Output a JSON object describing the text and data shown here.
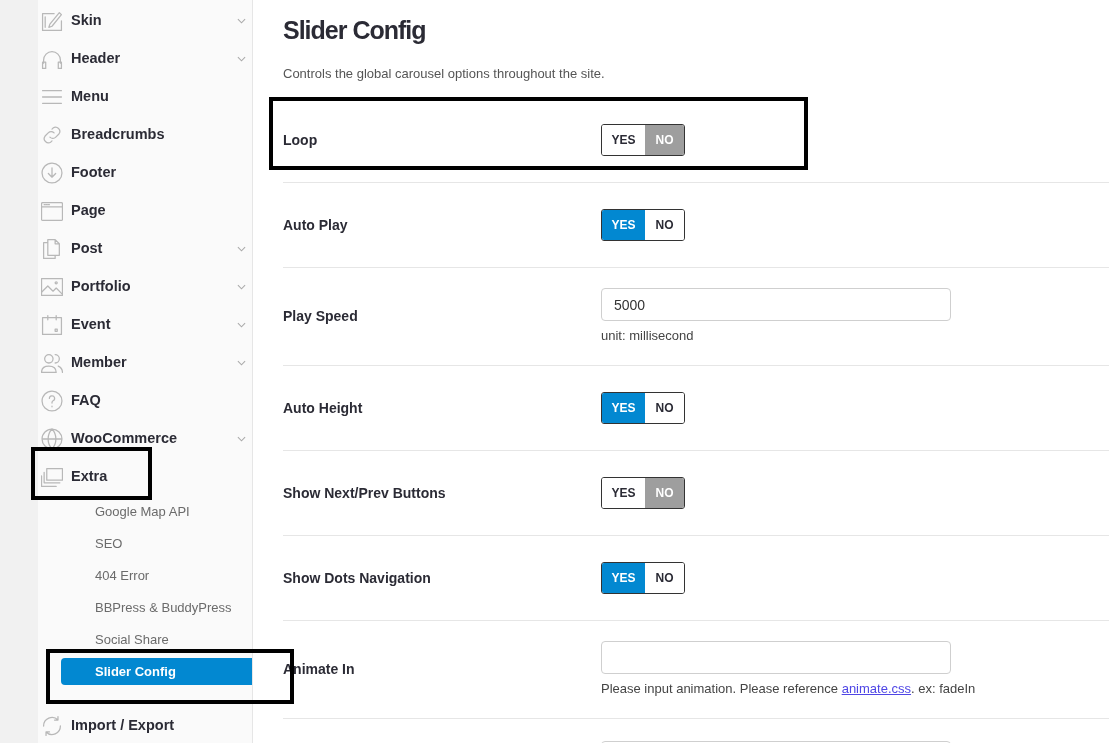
{
  "sidebar": {
    "items": [
      {
        "label": "Skin",
        "expandable": true,
        "highlighted": false
      },
      {
        "label": "Header",
        "expandable": true,
        "highlighted": false
      },
      {
        "label": "Menu",
        "expandable": false,
        "highlighted": false
      },
      {
        "label": "Breadcrumbs",
        "expandable": false,
        "highlighted": false
      },
      {
        "label": "Footer",
        "expandable": false,
        "highlighted": false
      },
      {
        "label": "Page",
        "expandable": false,
        "highlighted": false
      },
      {
        "label": "Post",
        "expandable": true,
        "highlighted": false
      },
      {
        "label": "Portfolio",
        "expandable": true,
        "highlighted": false
      },
      {
        "label": "Event",
        "expandable": true,
        "highlighted": false
      },
      {
        "label": "Member",
        "expandable": true,
        "highlighted": false
      },
      {
        "label": "FAQ",
        "expandable": false,
        "highlighted": false
      },
      {
        "label": "WooCommerce",
        "expandable": true,
        "highlighted": false
      },
      {
        "label": "Extra",
        "expandable": false,
        "highlighted": true,
        "children": [
          {
            "label": "Google Map API",
            "selected": false,
            "highlighted": false
          },
          {
            "label": "SEO",
            "selected": false,
            "highlighted": false
          },
          {
            "label": "404 Error",
            "selected": false,
            "highlighted": false
          },
          {
            "label": "BBPress & BuddyPress",
            "selected": false,
            "highlighted": false
          },
          {
            "label": "Social Share",
            "selected": false,
            "highlighted": false
          },
          {
            "label": "Slider Config",
            "selected": true,
            "highlighted": true
          }
        ]
      },
      {
        "label": "Import / Export",
        "expandable": false,
        "highlighted": false
      }
    ]
  },
  "main": {
    "title": "Slider Config",
    "description": "Controls the global carousel options throughout the site.",
    "rows": [
      {
        "kind": "toggle",
        "label": "Loop",
        "highlighted": true,
        "options": [
          {
            "label": "YES",
            "selected": false
          },
          {
            "label": "NO",
            "selected": true
          }
        ]
      },
      {
        "kind": "toggle",
        "label": "Auto Play",
        "highlighted": false,
        "options": [
          {
            "label": "YES",
            "selected": true
          },
          {
            "label": "NO",
            "selected": false
          }
        ]
      },
      {
        "kind": "text",
        "label": "Play Speed",
        "highlighted": false,
        "value": "5000",
        "help": "unit: millisecond"
      },
      {
        "kind": "toggle",
        "label": "Auto Height",
        "highlighted": false,
        "options": [
          {
            "label": "YES",
            "selected": true
          },
          {
            "label": "NO",
            "selected": false
          }
        ]
      },
      {
        "kind": "toggle",
        "label": "Show Next/Prev Buttons",
        "highlighted": false,
        "options": [
          {
            "label": "YES",
            "selected": false
          },
          {
            "label": "NO",
            "selected": true
          }
        ]
      },
      {
        "kind": "toggle",
        "label": "Show Dots Navigation",
        "highlighted": false,
        "options": [
          {
            "label": "YES",
            "selected": true
          },
          {
            "label": "NO",
            "selected": false
          }
        ]
      },
      {
        "kind": "text",
        "label": "Animate In",
        "highlighted": false,
        "help": "Please input animation. Please reference ",
        "help_link": "animate.css",
        "help_after": ". ex: fadeIn"
      },
      {
        "kind": "text",
        "highlighted": false
      }
    ]
  }
}
